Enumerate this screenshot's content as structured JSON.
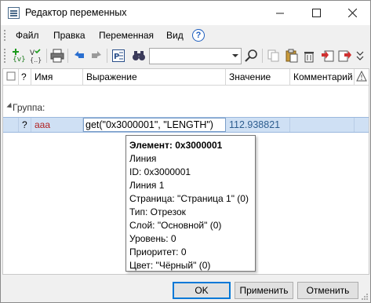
{
  "window": {
    "title": "Редактор переменных"
  },
  "menu": {
    "items": [
      "Файл",
      "Правка",
      "Переменная",
      "Вид"
    ],
    "help_glyph": "?"
  },
  "toolbar": {
    "icons": [
      "add-variable-icon",
      "add-variable-list-icon",
      "print-icon",
      "undo-icon",
      "redo-icon",
      "formula-icon",
      "binoculars-icon",
      "search-icon",
      "copy-icon",
      "paste-icon",
      "delete-icon",
      "import-icon",
      "export-icon"
    ],
    "search_value": ""
  },
  "grid": {
    "columns": [
      "",
      "?",
      "Имя",
      "Выражение",
      "Значение",
      "Комментарий",
      "!"
    ],
    "group_label": "Группа:",
    "rows": [
      {
        "flag": "",
        "q": "?",
        "name": "aaa",
        "expression": "get(\"0x3000001\", \"LENGTH\")",
        "value": "112.938821",
        "comment": ""
      }
    ]
  },
  "tooltip": {
    "title": "Элемент: 0x3000001",
    "lines": [
      "Линия",
      "ID: 0x3000001",
      "Линия 1",
      "Страница: \"Страница 1\" (0)",
      "Тип: Отрезок",
      "Слой: \"Основной\" (0)",
      "Уровень: 0",
      "Приоритет: 0",
      "Цвет: \"Чёрный\" (0)"
    ]
  },
  "buttons": {
    "ok": "OK",
    "apply": "Применить",
    "cancel": "Отменить"
  }
}
